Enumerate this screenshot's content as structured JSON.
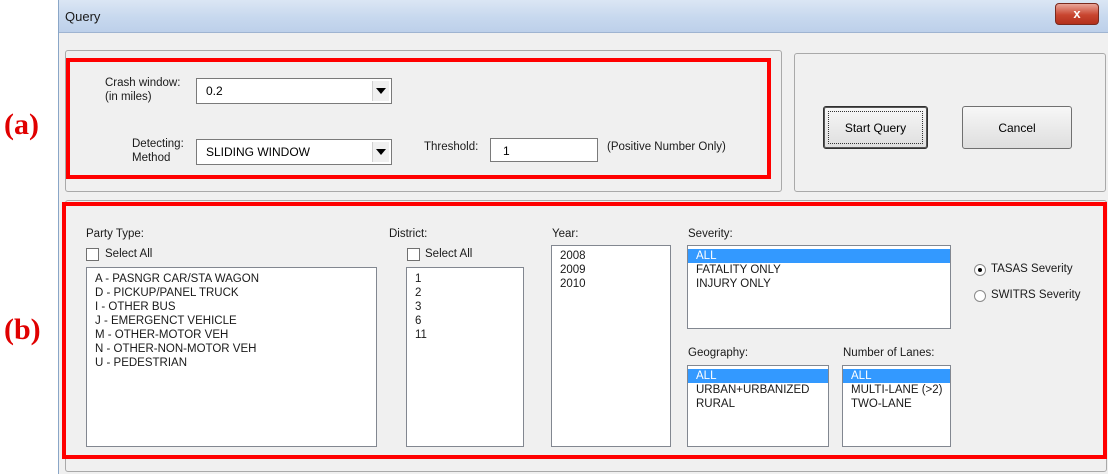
{
  "window": {
    "title": "Query",
    "close_glyph": "x"
  },
  "annotations": {
    "a": "(a)",
    "b": "(b)"
  },
  "top": {
    "crash_window_label": "Crash window:",
    "crash_window_sublabel": "(in miles)",
    "crash_window_value": "0.2",
    "detecting_label": "Detecting:",
    "detecting_sublabel": "Method",
    "detecting_value": "SLIDING WINDOW",
    "threshold_label": "Threshold:",
    "threshold_value": "1",
    "threshold_hint": "(Positive Number Only)"
  },
  "actions": {
    "start_query": "Start Query",
    "cancel": "Cancel"
  },
  "party_type": {
    "label": "Party Type:",
    "select_all": "Select All",
    "items": [
      "A - PASNGR CAR/STA WAGON",
      "D - PICKUP/PANEL TRUCK",
      "I - OTHER BUS",
      "J - EMERGENCT VEHICLE",
      "M - OTHER-MOTOR VEH",
      "N - OTHER-NON-MOTOR VEH",
      "U - PEDESTRIAN"
    ]
  },
  "district": {
    "label": "District:",
    "select_all": "Select All",
    "items": [
      "1",
      "2",
      "3",
      "6",
      "11"
    ]
  },
  "year": {
    "label": "Year:",
    "items": [
      "2008",
      "2009",
      "2010"
    ]
  },
  "severity": {
    "label": "Severity:",
    "items": [
      "ALL",
      "FATALITY ONLY",
      "INJURY ONLY"
    ],
    "selected": "ALL"
  },
  "severity_type": {
    "options": [
      "TASAS Severity",
      "SWITRS Severity"
    ],
    "selected": "TASAS Severity"
  },
  "geography": {
    "label": "Geography:",
    "items": [
      "ALL",
      "URBAN+URBANIZED",
      "RURAL"
    ],
    "selected": "ALL"
  },
  "lanes": {
    "label": "Number of Lanes:",
    "items": [
      "ALL",
      "MULTI-LANE (>2)",
      "TWO-LANE"
    ],
    "selected": "ALL"
  },
  "colors": {
    "selection": "#3399ff",
    "highlight_box": "#ff0000",
    "annotation": "#e00000"
  }
}
